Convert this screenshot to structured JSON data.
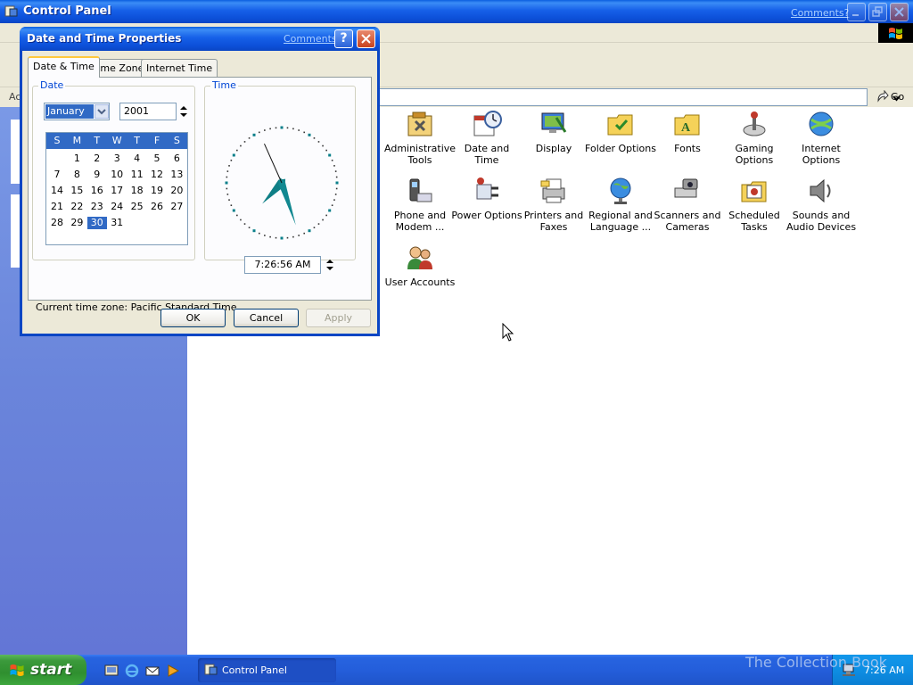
{
  "control_panel": {
    "title": "Control Panel",
    "comments_link": "Comments?",
    "address_label": "Ac",
    "go_label": "Go",
    "items": [
      {
        "label": "Administrative\nTools",
        "icon": "administrative-tools-icon"
      },
      {
        "label": "Date and Time",
        "icon": "date-and-time-icon"
      },
      {
        "label": "Display",
        "icon": "display-icon"
      },
      {
        "label": "Folder Options",
        "icon": "folder-options-icon"
      },
      {
        "label": "Fonts",
        "icon": "fonts-icon"
      },
      {
        "label": "Gaming\nOptions",
        "icon": "gaming-options-icon"
      },
      {
        "label": "Internet\nOptions",
        "icon": "internet-options-icon"
      },
      {
        "label": "Phone and\nModem ...",
        "icon": "phone-modem-icon"
      },
      {
        "label": "Power Options",
        "icon": "power-options-icon"
      },
      {
        "label": "Printers and\nFaxes",
        "icon": "printers-faxes-icon"
      },
      {
        "label": "Regional and\nLanguage ...",
        "icon": "regional-language-icon"
      },
      {
        "label": "Scanners and\nCameras",
        "icon": "scanners-cameras-icon"
      },
      {
        "label": "Scheduled\nTasks",
        "icon": "scheduled-tasks-icon"
      },
      {
        "label": "Sounds and\nAudio Devices",
        "icon": "sounds-audio-icon"
      },
      {
        "label": "User Accounts",
        "icon": "user-accounts-icon"
      }
    ]
  },
  "dialog": {
    "title": "Date and Time Properties",
    "comments_link": "Comments?",
    "help_label": "?",
    "tabs": [
      "Date & Time",
      "Time Zone",
      "Internet Time"
    ],
    "date_group_label": "Date",
    "time_group_label": "Time",
    "month": "January",
    "year": "2001",
    "weekday_headers": [
      "S",
      "M",
      "T",
      "W",
      "T",
      "F",
      "S"
    ],
    "first_weekday_index": 1,
    "days_in_month": 31,
    "selected_day": 30,
    "time": "7:26:56 AM",
    "clock": {
      "hour": 7,
      "minute": 26,
      "second": 56
    },
    "timezone_text": "Current time zone:  Pacific Standard Time",
    "buttons": {
      "ok": "OK",
      "cancel": "Cancel",
      "apply": "Apply"
    }
  },
  "taskbar": {
    "start_label": "start",
    "task_label": "Control Panel",
    "clock": "7:26 AM",
    "watermark": "The Collection Book"
  },
  "colors": {
    "titlebar_blue": "#0a46c4",
    "selection_blue": "#316ac5",
    "group_label_blue": "#0046d5",
    "start_green": "#3c9a3c",
    "sidebar_blue": "#6a85db"
  }
}
